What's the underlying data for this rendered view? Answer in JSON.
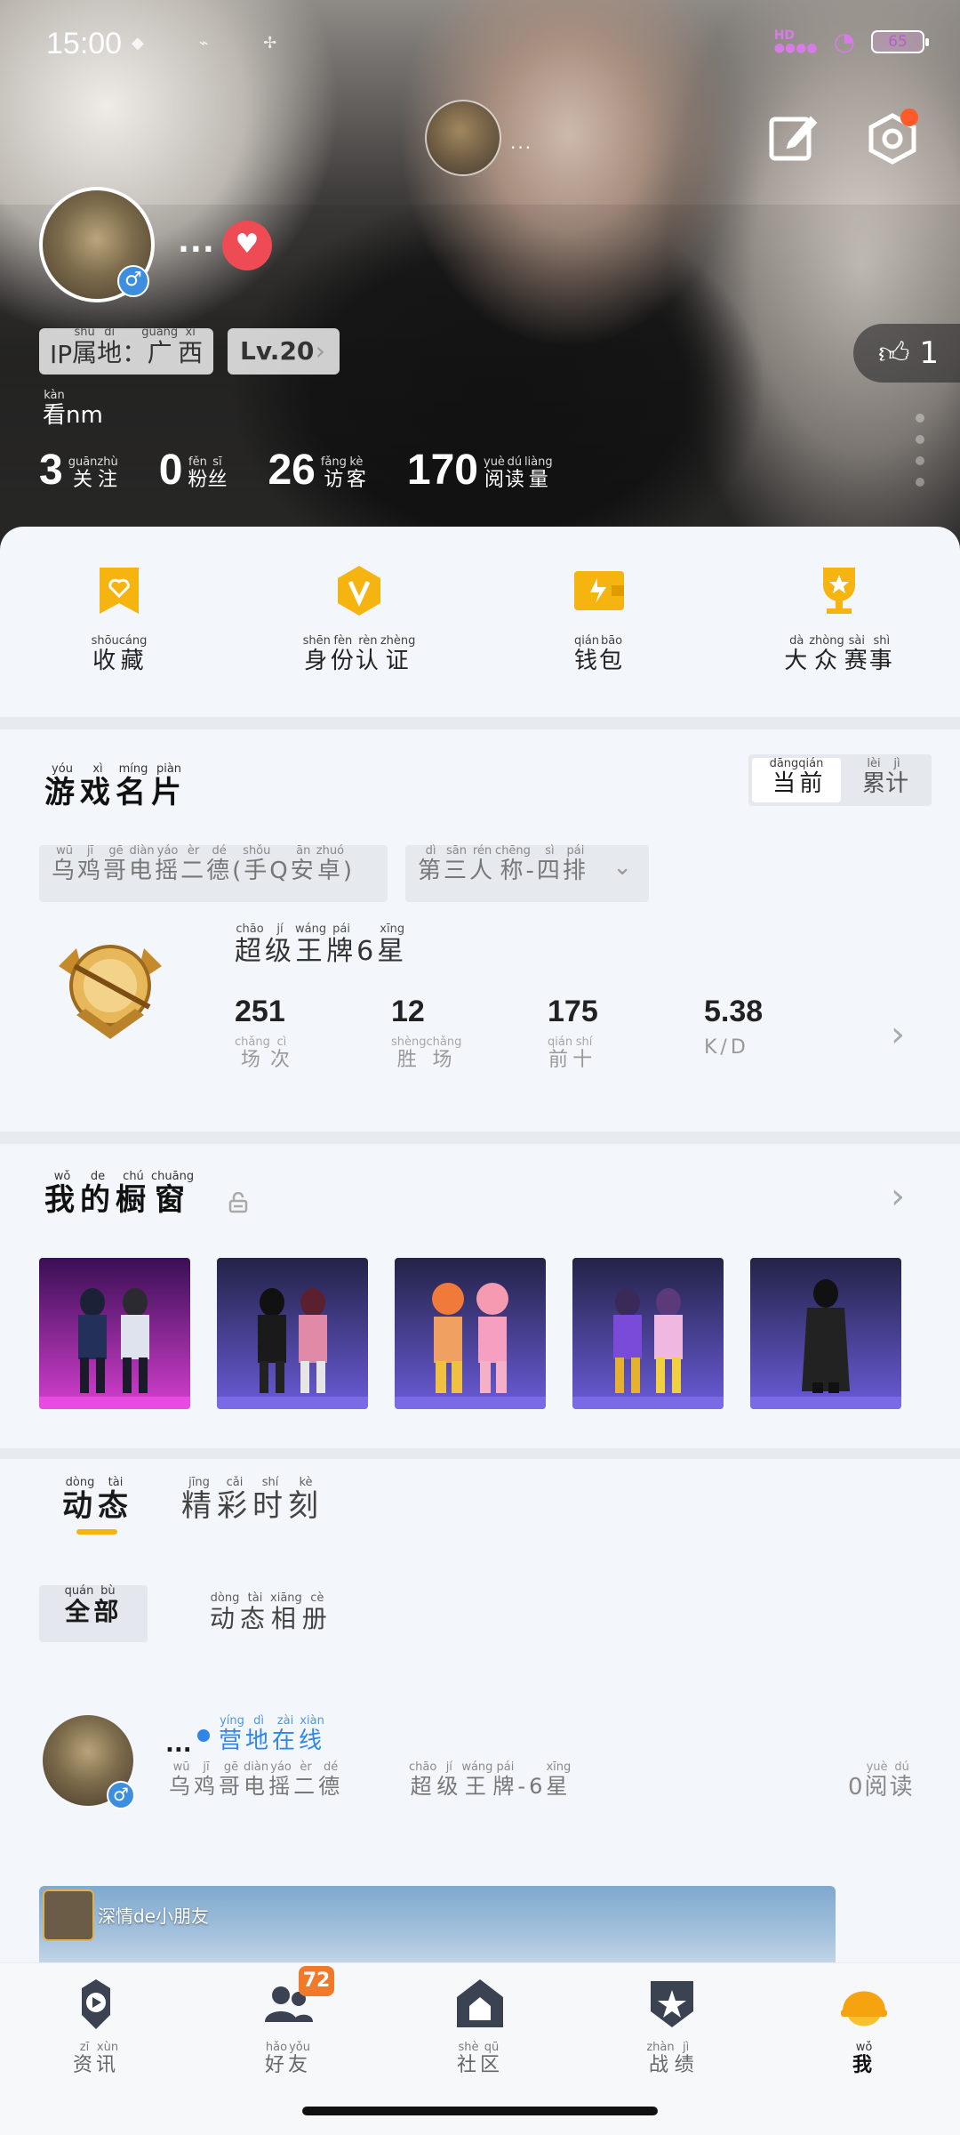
{
  "status_bar": {
    "time": "15:00",
    "battery": "65",
    "signal_label": "HD"
  },
  "header": {
    "center_name": "...",
    "nickname": "...",
    "gender": "♂",
    "ip_label": "IP",
    "ip_region": [
      {
        "t": "属",
        "p": "shǔ"
      },
      {
        "t": "地",
        "p": "dì"
      },
      {
        "t": "：",
        "p": ""
      },
      {
        "t": "广",
        "p": "guǎng"
      },
      {
        "t": "西",
        "p": "xī"
      }
    ],
    "level": "Lv.20",
    "likes": "1",
    "bio_char": {
      "t": "看",
      "p": "kàn"
    },
    "bio_rest": "nm",
    "stats": [
      {
        "num": "3",
        "label": [
          {
            "t": "关",
            "p": "guān"
          },
          {
            "t": "注",
            "p": "zhù"
          }
        ]
      },
      {
        "num": "0",
        "label": [
          {
            "t": "粉",
            "p": "fěn"
          },
          {
            "t": "丝",
            "p": "sī"
          }
        ]
      },
      {
        "num": "26",
        "label": [
          {
            "t": "访",
            "p": "fǎng"
          },
          {
            "t": "客",
            "p": "kè"
          }
        ]
      },
      {
        "num": "170",
        "label": [
          {
            "t": "阅",
            "p": "yuè"
          },
          {
            "t": "读",
            "p": "dú"
          },
          {
            "t": "量",
            "p": "liàng"
          }
        ]
      }
    ]
  },
  "quick_actions": [
    {
      "icon": "favorite-icon",
      "label": [
        {
          "t": "收",
          "p": "shōu"
        },
        {
          "t": "藏",
          "p": "cáng"
        }
      ]
    },
    {
      "icon": "verify-icon",
      "label": [
        {
          "t": "身",
          "p": "shēn"
        },
        {
          "t": "份",
          "p": "fèn"
        },
        {
          "t": "认",
          "p": "rèn"
        },
        {
          "t": "证",
          "p": "zhèng"
        }
      ]
    },
    {
      "icon": "wallet-icon",
      "label": [
        {
          "t": "钱",
          "p": "qián"
        },
        {
          "t": "包",
          "p": "bāo"
        }
      ]
    },
    {
      "icon": "trophy-icon",
      "label": [
        {
          "t": "大",
          "p": "dà"
        },
        {
          "t": "众",
          "p": "zhòng"
        },
        {
          "t": "赛",
          "p": "sài"
        },
        {
          "t": "事",
          "p": "shì"
        }
      ]
    }
  ],
  "game_card": {
    "title": [
      {
        "t": "游",
        "p": "yóu"
      },
      {
        "t": "戏",
        "p": "xì"
      },
      {
        "t": "名",
        "p": "míng"
      },
      {
        "t": "片",
        "p": "piàn"
      }
    ],
    "toggle_current": [
      {
        "t": "当",
        "p": "dāng"
      },
      {
        "t": "前",
        "p": "qián"
      }
    ],
    "toggle_total": [
      {
        "t": "累",
        "p": "lèi"
      },
      {
        "t": "计",
        "p": "jì"
      }
    ],
    "server_chip": [
      {
        "t": "乌",
        "p": "wū"
      },
      {
        "t": "鸡",
        "p": "jī"
      },
      {
        "t": "哥",
        "p": "gē"
      },
      {
        "t": "电",
        "p": "diàn"
      },
      {
        "t": "摇",
        "p": "yáo"
      },
      {
        "t": "二",
        "p": "èr"
      },
      {
        "t": "德",
        "p": "dé"
      },
      {
        "t": "(",
        "p": ""
      },
      {
        "t": "手",
        "p": "shǒu"
      },
      {
        "t": "Q",
        "p": ""
      },
      {
        "t": "安",
        "p": "ān"
      },
      {
        "t": "卓",
        "p": "zhuó"
      },
      {
        "t": ")",
        "p": ""
      }
    ],
    "mode_chip": [
      {
        "t": "第",
        "p": "dì"
      },
      {
        "t": "三",
        "p": "sān"
      },
      {
        "t": "人",
        "p": "rén"
      },
      {
        "t": "称",
        "p": "chēng"
      },
      {
        "t": "-",
        "p": ""
      },
      {
        "t": "四",
        "p": "sì"
      },
      {
        "t": "排",
        "p": "pái"
      }
    ],
    "rank_name": [
      {
        "t": "超",
        "p": "chāo"
      },
      {
        "t": "级",
        "p": "jí"
      },
      {
        "t": "王",
        "p": "wáng"
      },
      {
        "t": "牌",
        "p": "pái"
      },
      {
        "t": "6",
        "p": ""
      },
      {
        "t": "星",
        "p": "xīng"
      }
    ],
    "stats": [
      {
        "value": "251",
        "label": [
          {
            "t": "场",
            "p": "chǎng"
          },
          {
            "t": "次",
            "p": "cì"
          }
        ]
      },
      {
        "value": "12",
        "label": [
          {
            "t": "胜",
            "p": "shèng"
          },
          {
            "t": "场",
            "p": "chǎng"
          }
        ]
      },
      {
        "value": "175",
        "label": [
          {
            "t": "前",
            "p": "qián"
          },
          {
            "t": "十",
            "p": "shí"
          }
        ]
      },
      {
        "value": "5.38",
        "label": [
          {
            "t": "K/D",
            "p": ""
          }
        ]
      }
    ]
  },
  "showcase": {
    "title": [
      {
        "t": "我",
        "p": "wǒ"
      },
      {
        "t": "的",
        "p": "de"
      },
      {
        "t": "橱",
        "p": "chú"
      },
      {
        "t": "窗",
        "p": "chuāng"
      }
    ],
    "items": [
      "skin-1",
      "skin-2",
      "skin-3",
      "skin-4",
      "skin-5"
    ]
  },
  "feed": {
    "tab_active": [
      {
        "t": "动",
        "p": "dòng"
      },
      {
        "t": "态",
        "p": "tài"
      }
    ],
    "tab_other": [
      {
        "t": "精",
        "p": "jīng"
      },
      {
        "t": "彩",
        "p": "cǎi"
      },
      {
        "t": "时",
        "p": "shí"
      },
      {
        "t": "刻",
        "p": "kè"
      }
    ],
    "filter_all": [
      {
        "t": "全",
        "p": "quán"
      },
      {
        "t": "部",
        "p": "bù"
      }
    ],
    "filter_album": [
      {
        "t": "动",
        "p": "dòng"
      },
      {
        "t": "态",
        "p": "tài"
      },
      {
        "t": "相",
        "p": "xiāng"
      },
      {
        "t": "册",
        "p": "cè"
      }
    ],
    "post": {
      "nickname": "...",
      "online": [
        {
          "t": "营",
          "p": "yíng"
        },
        {
          "t": "地",
          "p": "dì"
        },
        {
          "t": "在",
          "p": "zài"
        },
        {
          "t": "线",
          "p": "xiàn"
        }
      ],
      "server": [
        {
          "t": "乌",
          "p": "wū"
        },
        {
          "t": "鸡",
          "p": "jī"
        },
        {
          "t": "哥",
          "p": "gē"
        },
        {
          "t": "电",
          "p": "diàn"
        },
        {
          "t": "摇",
          "p": "yáo"
        },
        {
          "t": "二",
          "p": "èr"
        },
        {
          "t": "德",
          "p": "dé"
        }
      ],
      "rank": [
        {
          "t": "超",
          "p": "chāo"
        },
        {
          "t": "级",
          "p": "jí"
        },
        {
          "t": "王",
          "p": "wáng"
        },
        {
          "t": "牌",
          "p": "pái"
        },
        {
          "t": "-",
          "p": ""
        },
        {
          "t": "6",
          "p": ""
        },
        {
          "t": "星",
          "p": "xīng"
        }
      ],
      "reads_num": "0",
      "reads_label": [
        {
          "t": "阅",
          "p": "yuè"
        },
        {
          "t": "读",
          "p": "dú"
        }
      ],
      "image_user": "深情de小朋友"
    }
  },
  "bottom_nav": [
    {
      "icon": "news-icon",
      "label": [
        {
          "t": "资",
          "p": "zī"
        },
        {
          "t": "讯",
          "p": "xùn"
        }
      ]
    },
    {
      "icon": "friends-icon",
      "label": [
        {
          "t": "好",
          "p": "hǎo"
        },
        {
          "t": "友",
          "p": "yǒu"
        }
      ],
      "badge": "72"
    },
    {
      "icon": "community-icon",
      "label": [
        {
          "t": "社",
          "p": "shè"
        },
        {
          "t": "区",
          "p": "qū"
        }
      ]
    },
    {
      "icon": "stats-icon",
      "label": [
        {
          "t": "战",
          "p": "zhàn"
        },
        {
          "t": "绩",
          "p": "jì"
        }
      ]
    },
    {
      "icon": "me-icon",
      "label": [
        {
          "t": "我",
          "p": "wǒ"
        }
      ],
      "active": true
    }
  ],
  "colors": {
    "accent": "#f5b40f",
    "online": "#2f86e8",
    "heart": "#ef4b55",
    "badge": "#f07a2a"
  }
}
